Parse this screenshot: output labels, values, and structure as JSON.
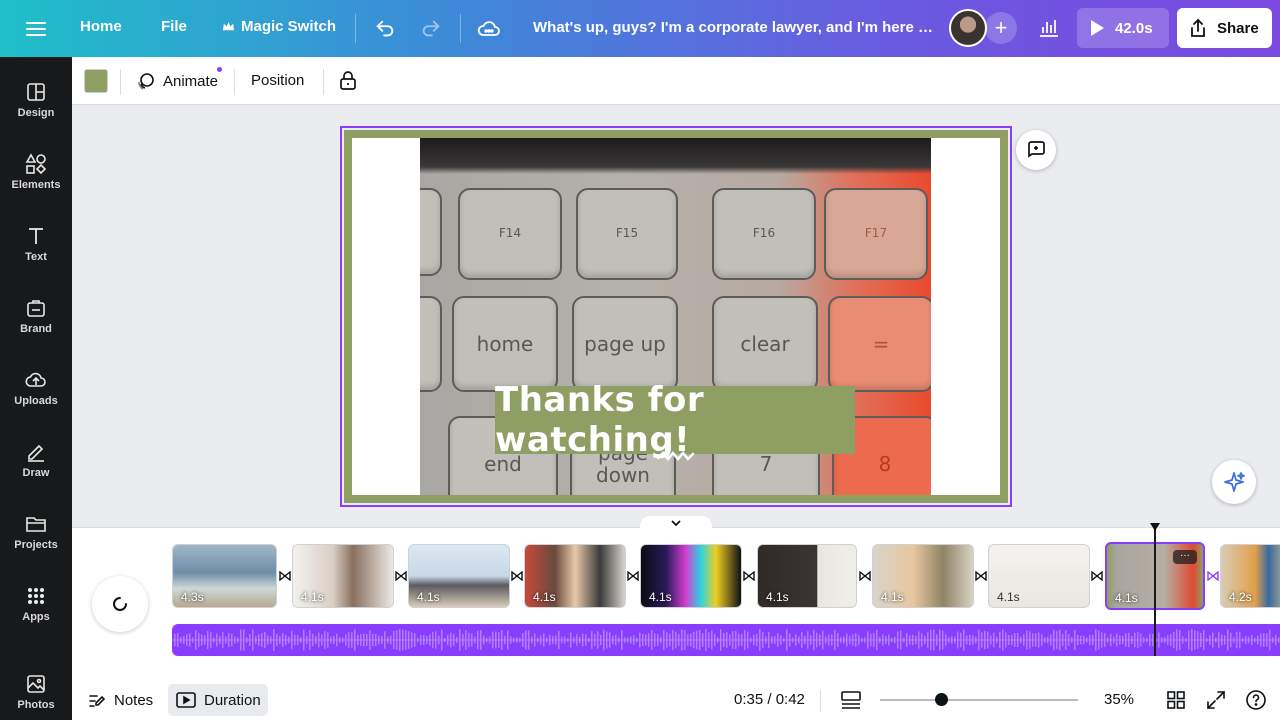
{
  "topbar": {
    "home": "Home",
    "file": "File",
    "magic_switch": "Magic Switch",
    "title": "What's up, guys? I'm a corporate lawyer, and I'm here to ...",
    "play_duration": "42.0s",
    "share": "Share"
  },
  "sidebar": {
    "items": [
      {
        "label": "Design",
        "icon": "layout-icon"
      },
      {
        "label": "Elements",
        "icon": "shapes-icon"
      },
      {
        "label": "Text",
        "icon": "text-icon"
      },
      {
        "label": "Brand",
        "icon": "brand-icon"
      },
      {
        "label": "Uploads",
        "icon": "cloud-upload-icon"
      },
      {
        "label": "Draw",
        "icon": "pen-icon"
      },
      {
        "label": "Projects",
        "icon": "folder-icon"
      },
      {
        "label": "Apps",
        "icon": "apps-grid-icon"
      },
      {
        "label": "Photos",
        "icon": "photo-icon"
      }
    ]
  },
  "toolbar": {
    "animate": "Animate",
    "position": "Position",
    "color": "#8f9e63"
  },
  "canvas": {
    "caption": "Thanks for watching!",
    "keys": {
      "f14": "F14",
      "f15": "F15",
      "f16": "F16",
      "f17": "F17",
      "home": "home",
      "pageup": "page up",
      "clear": "clear",
      "equals": "=",
      "end": "end",
      "pagedown": "page down",
      "seven": "7",
      "eight": "8"
    }
  },
  "timeline": {
    "clips": [
      {
        "duration": "4.3s"
      },
      {
        "duration": "4.1s"
      },
      {
        "duration": "4.1s"
      },
      {
        "duration": "4.1s"
      },
      {
        "duration": "4.1s"
      },
      {
        "duration": "4.1s"
      },
      {
        "duration": "4.1s"
      },
      {
        "duration": "4.1s"
      },
      {
        "duration": "4.1s"
      },
      {
        "duration": "4.2s"
      }
    ],
    "selected_clip_index": 8
  },
  "bottombar": {
    "notes": "Notes",
    "duration": "Duration",
    "time": "0:35 / 0:42",
    "zoom": "35%"
  },
  "colors": {
    "accent": "#8b3dff",
    "brand_green": "#8f9e63"
  }
}
